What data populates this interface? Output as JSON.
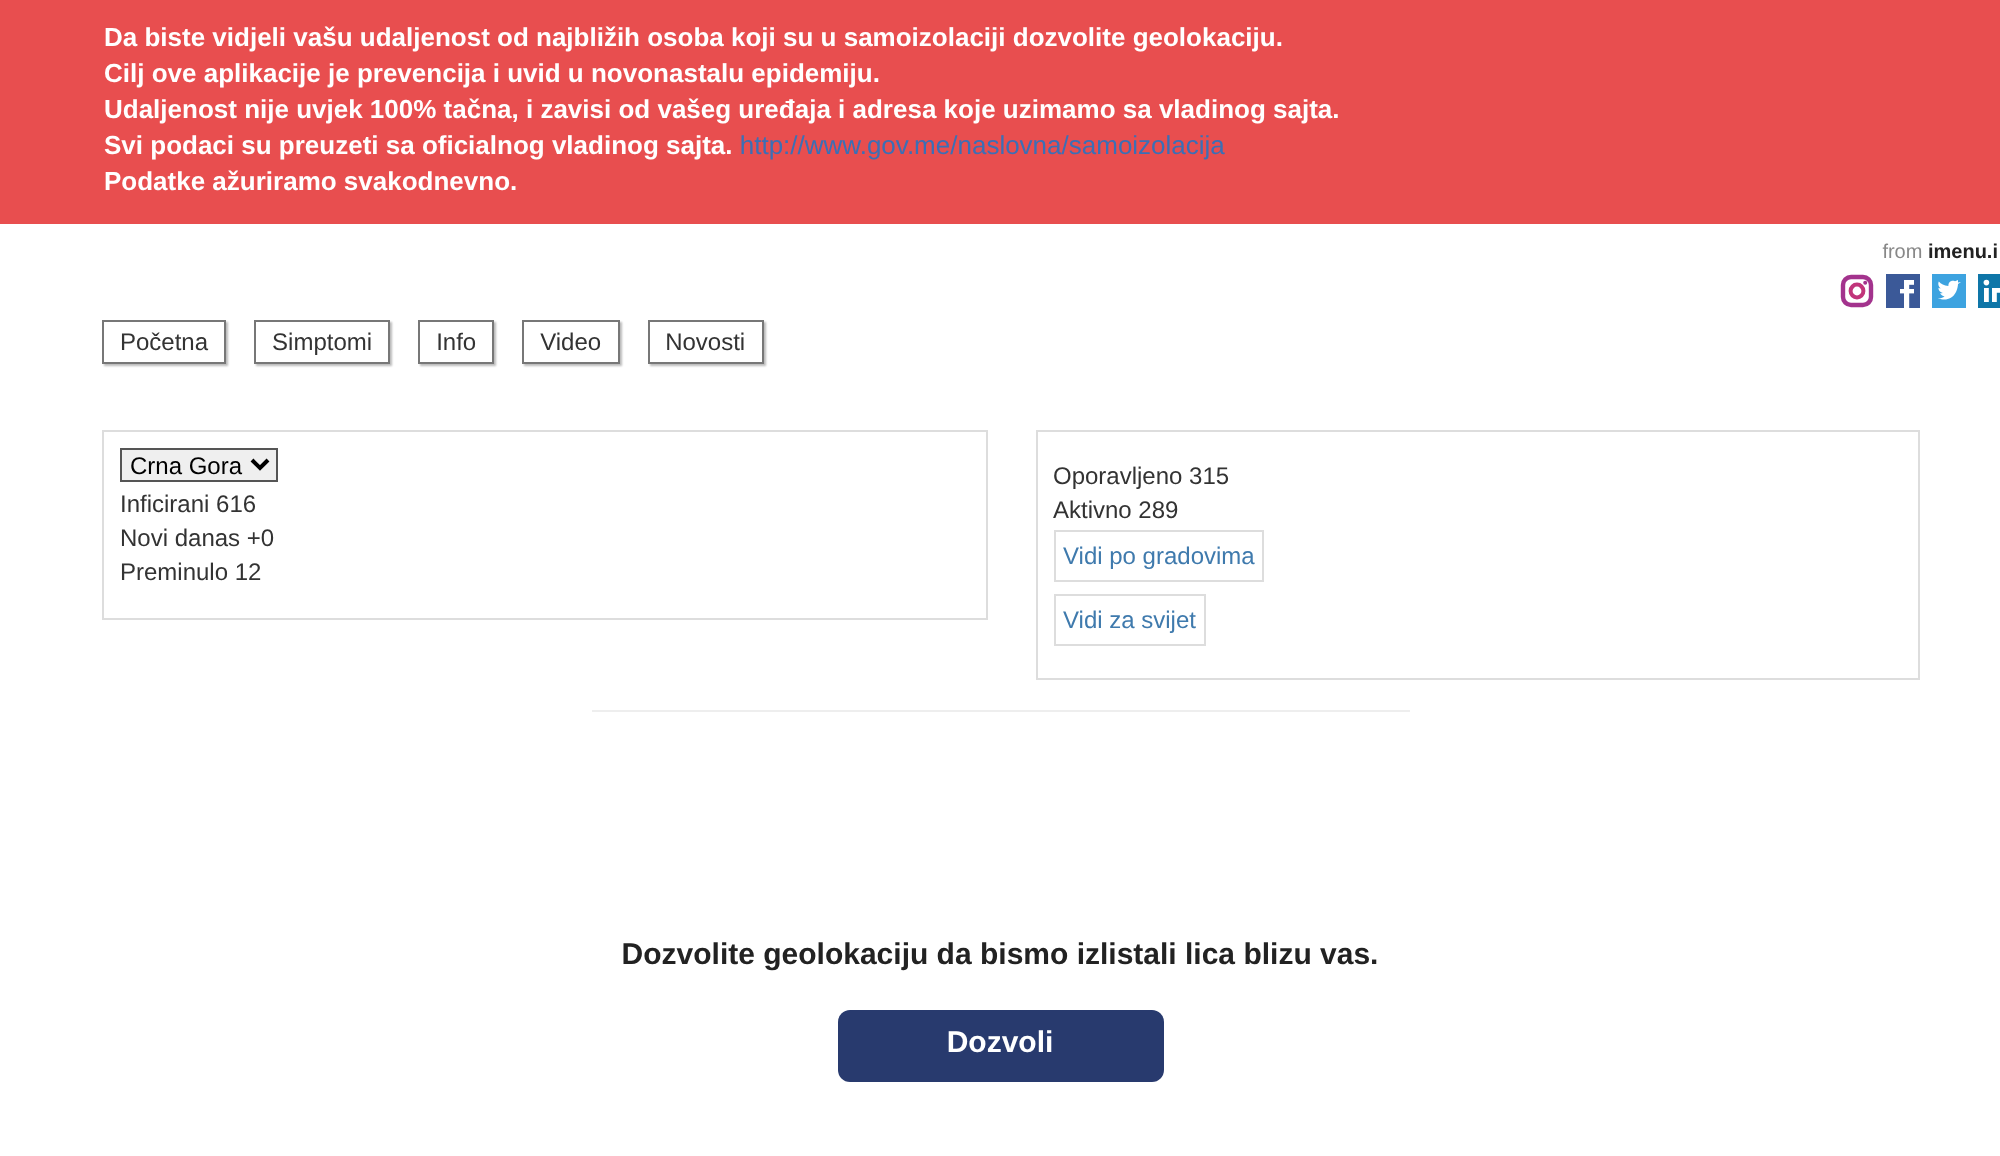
{
  "banner": {
    "lines": [
      {
        "text": "Da biste vidjeli vašu udaljenost od najbližih osoba koji su u samoizolaciji dozvolite geolokaciju."
      },
      {
        "text": "Cilj ove aplikacije je prevencija i uvid u novonastalu epidemiju."
      },
      {
        "text": "Udaljenost nije uvjek 100% tačna, i zavisi od vašeg uređaja i adresa koje uzimamo sa vladinog sajta."
      },
      {
        "text": "Svi podaci su preuzeti sa oficialnog vladinog sajta.",
        "link": "http://www.gov.me/naslovna/samoizolacija"
      },
      {
        "text": "Podatke ažuriramo svakodnevno."
      }
    ]
  },
  "attribution": {
    "prefix": "from",
    "site": "imenu.i"
  },
  "nav": [
    {
      "label": "Početna"
    },
    {
      "label": "Simptomi"
    },
    {
      "label": "Info"
    },
    {
      "label": "Video"
    },
    {
      "label": "Novosti"
    }
  ],
  "left_card": {
    "region": {
      "value": "Crna Gora"
    },
    "stats": [
      "Inficirani 616",
      "Novi danas +0",
      "Preminulo 12"
    ]
  },
  "right_card": {
    "stats": [
      "Oporavljeno 315",
      "Aktivno 289"
    ],
    "buttons": [
      "Vidi po gradovima",
      "Vidi za svijet"
    ]
  },
  "prompt": "Dozvolite geolokaciju da bismo izlistali lica blizu vas.",
  "allow_button": "Dozvoli"
}
